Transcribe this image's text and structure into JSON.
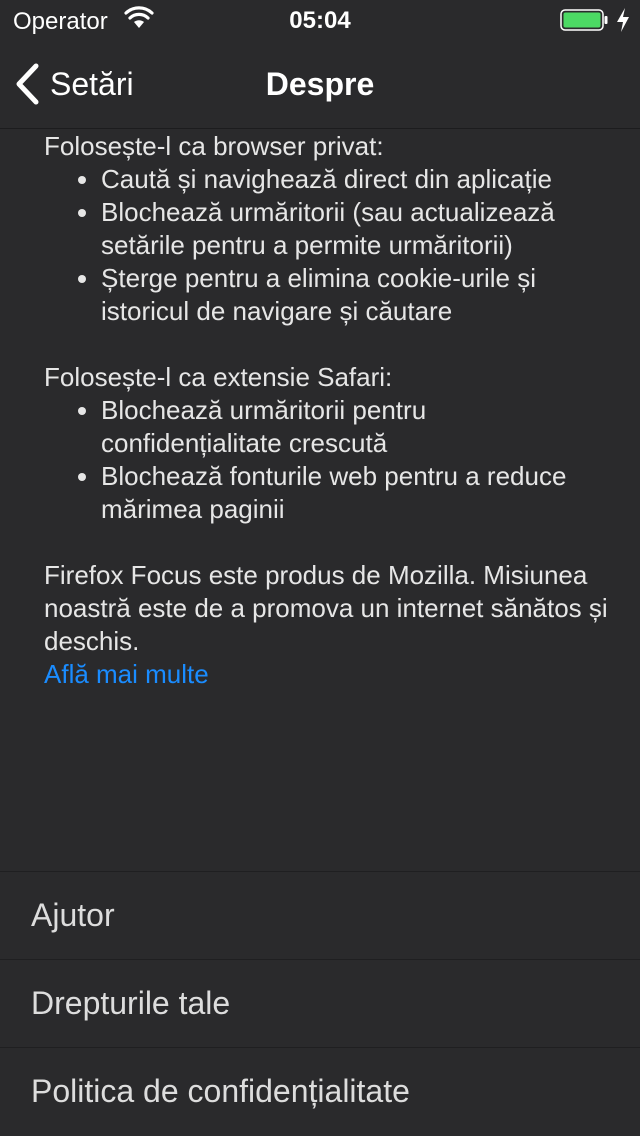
{
  "status_bar": {
    "carrier": "Operator",
    "time": "05:04",
    "battery_color": "#4cd964"
  },
  "nav": {
    "back_label": "Setări",
    "title": "Despre"
  },
  "about": {
    "private_heading": "Folosește-l ca browser privat:",
    "private_items": [
      "Caută și navighează direct din aplicație",
      "Blochează urmăritorii (sau actualizează setările pentru a permite urmăritorii)",
      "Șterge pentru a elimina cookie-urile și istoricul de navigare și căutare"
    ],
    "safari_heading": "Folosește-l ca extensie Safari:",
    "safari_items": [
      "Blochează urmăritorii pentru confidențialitate crescută",
      "Blochează fonturile web pentru a reduce mărimea paginii"
    ],
    "mission": "Firefox Focus este produs de Mozilla. Misiunea noastră este de a promova un internet sănătos și deschis.",
    "learn_more": "Află mai multe",
    "link_color": "#1a8cff"
  },
  "rows": [
    {
      "label": "Ajutor"
    },
    {
      "label": "Drepturile tale"
    },
    {
      "label": "Politica de confidențialitate"
    }
  ]
}
